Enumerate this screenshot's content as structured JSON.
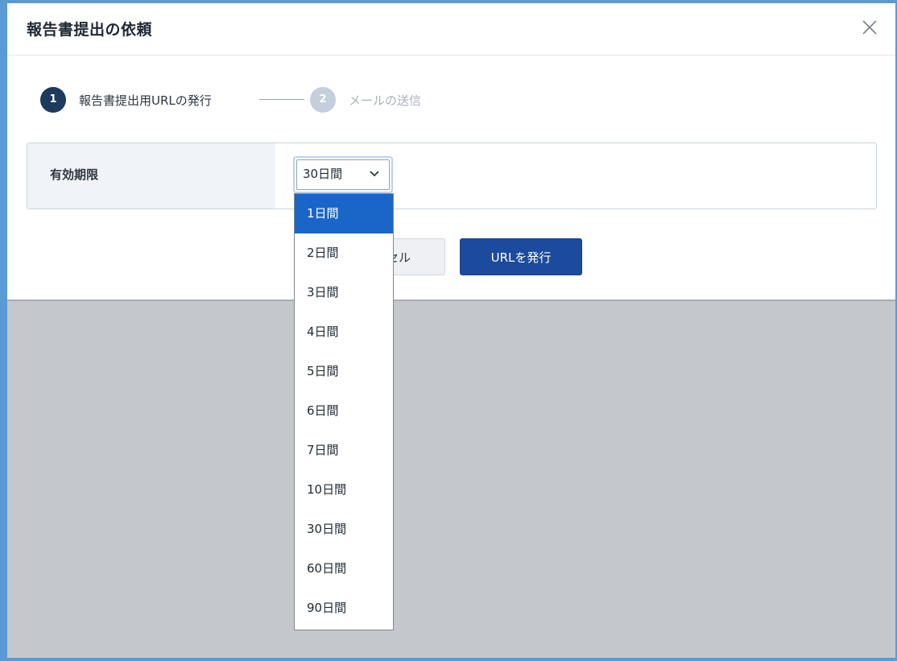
{
  "dialog": {
    "title": "報告書提出の依頼"
  },
  "stepper": {
    "steps": [
      {
        "number": "1",
        "label": "報告書提出用URLの発行",
        "state": "active"
      },
      {
        "number": "2",
        "label": "メールの送信",
        "state": "inactive"
      }
    ]
  },
  "form": {
    "expiry_label": "有効期限",
    "expiry_value": "30日間"
  },
  "dropdown": {
    "highlighted": "1日間",
    "options": [
      "1日間",
      "2日間",
      "3日間",
      "4日間",
      "5日間",
      "6日間",
      "7日間",
      "10日間",
      "30日間",
      "60日間",
      "90日間"
    ]
  },
  "buttons": {
    "cancel_label": "キャンセル",
    "cancel_visible_fragment": "セル",
    "issue_label": "URLを発行"
  },
  "icons": {
    "close": "close-icon",
    "select_chevron": "chevron-down-icon"
  },
  "colors": {
    "primary": "#1c4a9c",
    "step_active": "#1e3a5c",
    "step_inactive": "#c5cfdb",
    "option_highlight": "#1a66c8",
    "overlay": "#c4c8cc"
  }
}
